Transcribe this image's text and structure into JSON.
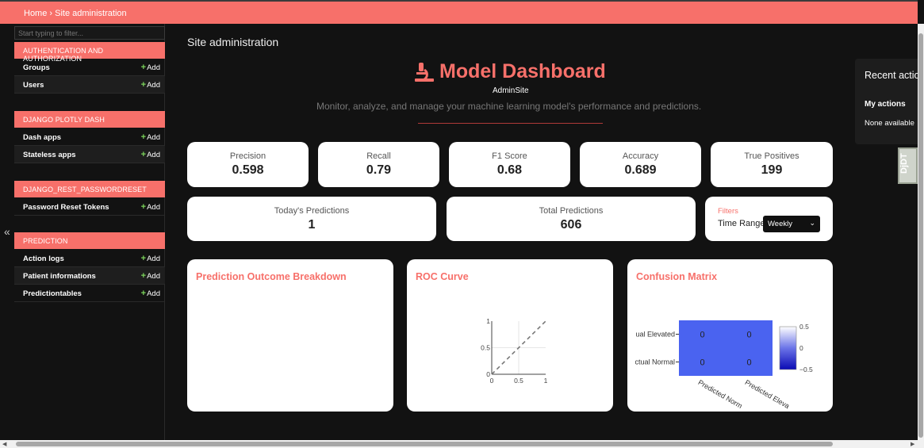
{
  "breadcrumb": {
    "home": "Home",
    "sep": "›",
    "current": "Site administration"
  },
  "sidebar": {
    "filter_placeholder": "Start typing to filter...",
    "collapse_glyph": "«",
    "add_label": "Add",
    "sections": [
      {
        "title": "AUTHENTICATION AND AUTHORIZATION",
        "items": [
          "Groups",
          "Users"
        ]
      },
      {
        "title": "DJANGO PLOTLY DASH",
        "items": [
          "Dash apps",
          "Stateless apps"
        ]
      },
      {
        "title": "DJANGO_REST_PASSWORDRESET",
        "items": [
          "Password Reset Tokens"
        ]
      },
      {
        "title": "PREDICTION",
        "items": [
          "Action logs",
          "Patient informations",
          "Predictiontables"
        ]
      }
    ]
  },
  "main": {
    "page_title": "Site administration",
    "dashboard_title": "Model Dashboard",
    "site_name": "AdminSite",
    "subtitle": "Monitor, analyze, and manage your machine learning model's performance and predictions."
  },
  "metrics": [
    {
      "label": "Precision",
      "value": "0.598"
    },
    {
      "label": "Recall",
      "value": "0.79"
    },
    {
      "label": "F1 Score",
      "value": "0.68"
    },
    {
      "label": "Accuracy",
      "value": "0.689"
    },
    {
      "label": "True Positives",
      "value": "199"
    }
  ],
  "predictions": [
    {
      "label": "Today's Predictions",
      "value": "1"
    },
    {
      "label": "Total Predictions",
      "value": "606"
    }
  ],
  "filters": {
    "title": "Filters",
    "time_range_label": "Time Range",
    "time_range_value": "Weekly"
  },
  "charts": {
    "outcome_title": "Prediction Outcome Breakdown",
    "roc_title": "ROC Curve",
    "cm_title": "Confusion Matrix"
  },
  "chart_data": [
    {
      "type": "line",
      "title": "ROC Curve",
      "series": [
        {
          "x": [
            0,
            1
          ],
          "y": [
            0,
            1
          ]
        }
      ],
      "xlim": [
        0,
        1
      ],
      "ylim": [
        0,
        1
      ],
      "xticks": [
        "0",
        "0.5",
        "1"
      ],
      "yticks": [
        "0",
        "0.5",
        "1"
      ],
      "grid": true
    },
    {
      "type": "heatmap",
      "title": "Confusion Matrix",
      "rows": [
        "ual Elevated",
        "ctual Normal"
      ],
      "cols": [
        "Predicted Norm",
        "Predicted Eleva"
      ],
      "values": [
        [
          0,
          0
        ],
        [
          0,
          0
        ]
      ],
      "colorbar_ticks": [
        "0.5",
        "0",
        "−0.5"
      ],
      "color": "#4a63f0"
    }
  ],
  "recent": {
    "title": "Recent actio",
    "my_actions": "My actions",
    "none": "None available"
  },
  "djdt": "DjDT",
  "colors": {
    "accent": "#f7706a",
    "heat": "#4a63f0"
  }
}
